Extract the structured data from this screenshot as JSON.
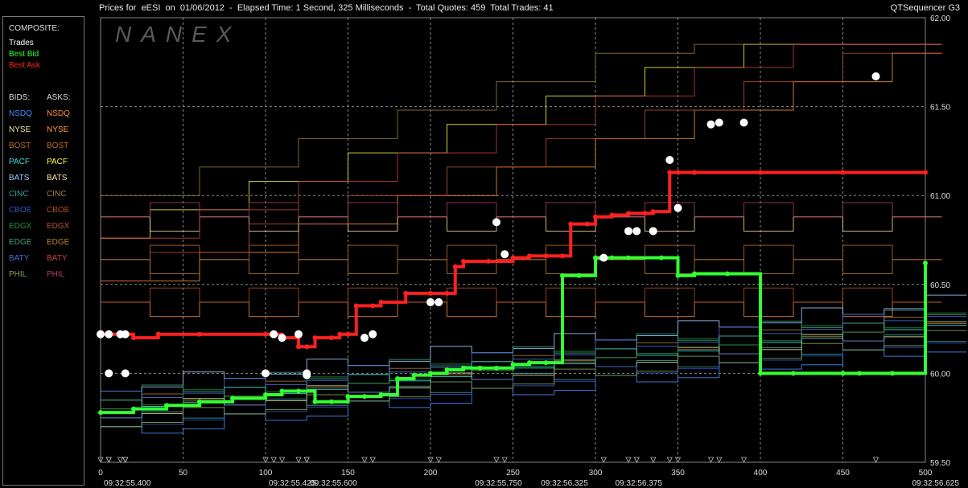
{
  "header": {
    "title": "Prices for  eESI  on  01/06/2012  -  Elapsed Time: 1 Second, 325 Milliseconds  -  Total Quotes: 459  Total Trades: 41",
    "app_name": "QTSequencer G3"
  },
  "watermark": "NANEX",
  "legend": {
    "composite_title": "COMPOSITE:",
    "composite": [
      {
        "label": "Trades",
        "color": "#ffffff"
      },
      {
        "label": "Best Bid",
        "color": "#33ff33"
      },
      {
        "label": "Best Ask",
        "color": "#ff2020"
      }
    ],
    "bids_title": "BIDS:",
    "asks_title": "ASKS:",
    "exchanges": [
      {
        "bid": "NSDQ",
        "ask": "NSDQ",
        "bid_color": "#4a8cff",
        "ask_color": "#ff8c3a"
      },
      {
        "bid": "NYSE",
        "ask": "NYSE",
        "bid_color": "#e6e6a0",
        "ask_color": "#ff9a3a"
      },
      {
        "bid": "BOST",
        "ask": "BOST",
        "bid_color": "#b07030",
        "ask_color": "#c06a2a"
      },
      {
        "bid": "PACF",
        "ask": "PACF",
        "bid_color": "#40e0e0",
        "ask_color": "#ffff40"
      },
      {
        "bid": "BATS",
        "ask": "BATS",
        "bid_color": "#9fc8ff",
        "ask_color": "#ffe0a0"
      },
      {
        "bid": "CINC",
        "ask": "CINC",
        "bid_color": "#3aa0a0",
        "ask_color": "#a08040"
      },
      {
        "bid": "CBOE",
        "ask": "CBOE",
        "bid_color": "#3050c0",
        "ask_color": "#b05020"
      },
      {
        "bid": "EDGX",
        "ask": "EDGX",
        "bid_color": "#209040",
        "ask_color": "#c05030"
      },
      {
        "bid": "EDGE",
        "ask": "EDGE",
        "bid_color": "#40a080",
        "ask_color": "#c08030"
      },
      {
        "bid": "BATY",
        "ask": "BATY",
        "bid_color": "#4a6ad0",
        "ask_color": "#d04040"
      },
      {
        "bid": "PHIL",
        "ask": "PHIL",
        "bid_color": "#80a060",
        "ask_color": "#b04060"
      }
    ]
  },
  "chart_data": {
    "type": "line",
    "xlim": [
      0,
      500
    ],
    "ylim": [
      59.5,
      62.0
    ],
    "y_ticks": [
      "62.00",
      "61.50",
      "61.00",
      "60.50",
      "60.00",
      "59.50"
    ],
    "y_tick_values": [
      62.0,
      61.5,
      61.0,
      60.5,
      60.0,
      59.5
    ],
    "x_ticks": [
      "0",
      "50",
      "100",
      "150",
      "200",
      "250",
      "300",
      "350",
      "400",
      "450",
      "500"
    ],
    "x_tick_values": [
      0,
      50,
      100,
      150,
      200,
      250,
      300,
      350,
      400,
      450,
      500
    ],
    "time_labels": [
      {
        "x": 0,
        "label": "09:32:55.400"
      },
      {
        "x": 100,
        "label": "09:32:55.425"
      },
      {
        "x": 125,
        "label": "09:32:55.600"
      },
      {
        "x": 225,
        "label": "09:32:55.750"
      },
      {
        "x": 265,
        "label": "09:32:56.325"
      },
      {
        "x": 310,
        "label": "09:32:56.375"
      },
      {
        "x": 490,
        "label": "09:32:56.625"
      }
    ],
    "grid": true,
    "series": [
      {
        "name": "Best Ask",
        "color": "#ff2020",
        "x": [
          0,
          20,
          35,
          60,
          100,
          110,
          120,
          125,
          130,
          140,
          145,
          150,
          155,
          165,
          170,
          185,
          200,
          210,
          215,
          220,
          235,
          250,
          260,
          270,
          280,
          285,
          295,
          300,
          310,
          320,
          330,
          335,
          345,
          350,
          360,
          400,
          450,
          500
        ],
        "y": [
          60.22,
          60.2,
          60.22,
          60.22,
          60.22,
          60.2,
          60.15,
          60.15,
          60.2,
          60.2,
          60.22,
          60.22,
          60.38,
          60.38,
          60.4,
          60.45,
          60.45,
          60.45,
          60.6,
          60.63,
          60.63,
          60.65,
          60.66,
          60.66,
          60.66,
          60.84,
          60.84,
          60.88,
          60.89,
          60.9,
          60.9,
          60.91,
          61.13,
          61.13,
          61.13,
          61.13,
          61.13,
          61.13
        ]
      },
      {
        "name": "Best Bid",
        "color": "#33ff33",
        "x": [
          0,
          20,
          40,
          60,
          80,
          100,
          110,
          120,
          130,
          140,
          150,
          160,
          170,
          180,
          190,
          200,
          210,
          220,
          230,
          240,
          250,
          260,
          270,
          280,
          290,
          300,
          310,
          320,
          340,
          350,
          360,
          380,
          400,
          420,
          450,
          460,
          480,
          500
        ],
        "y": [
          59.78,
          59.8,
          59.82,
          59.84,
          59.86,
          59.88,
          59.9,
          59.9,
          59.84,
          59.84,
          59.87,
          59.87,
          59.88,
          59.97,
          59.99,
          60.0,
          60.02,
          60.03,
          60.03,
          60.03,
          60.05,
          60.06,
          60.06,
          60.55,
          60.55,
          60.65,
          60.65,
          60.65,
          60.65,
          60.55,
          60.56,
          60.56,
          60.0,
          60.0,
          60.0,
          60.0,
          60.0,
          60.62
        ]
      },
      {
        "name": "Trades",
        "color": "#ffffff",
        "x": [
          0,
          5,
          12,
          15,
          5,
          15,
          105,
          110,
          120,
          125,
          160,
          165,
          200,
          205,
          240,
          245,
          305,
          320,
          325,
          335,
          345,
          350,
          370,
          375,
          390,
          470,
          100,
          125
        ],
        "y": [
          60.22,
          60.22,
          60.22,
          60.22,
          60.0,
          60.0,
          60.22,
          60.2,
          60.22,
          60.0,
          60.2,
          60.22,
          60.4,
          60.4,
          60.85,
          60.67,
          60.65,
          60.8,
          60.8,
          60.8,
          61.2,
          60.93,
          61.4,
          61.41,
          61.41,
          61.67,
          60.0,
          59.99
        ]
      }
    ]
  }
}
